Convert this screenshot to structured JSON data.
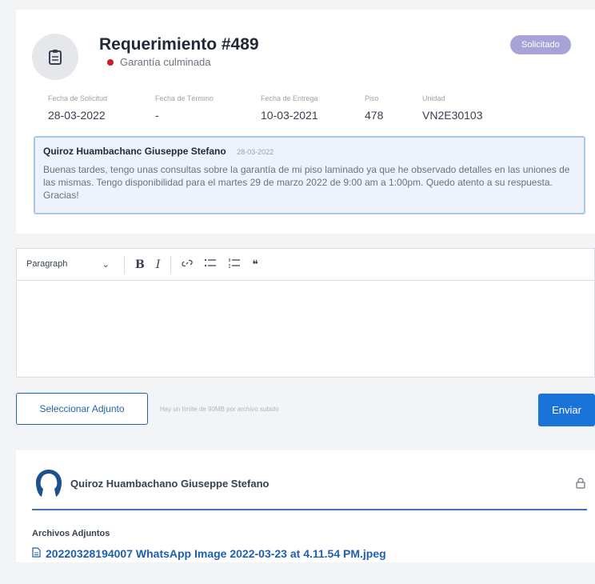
{
  "request": {
    "title": "Requerimiento #489",
    "status_text": "Garantía culminada",
    "badge": "Solicitado",
    "colors": {
      "badge": "#a8a3d6",
      "status_dot": "#c81e1e"
    }
  },
  "fields": [
    {
      "label": "Fecha de Solicitud",
      "value": "28-03-2022"
    },
    {
      "label": "Fecha de Término",
      "value": "-"
    },
    {
      "label": "Fecha de Entrega",
      "value": "10-03-2021"
    },
    {
      "label": "Piso",
      "value": "478"
    },
    {
      "label": "Unidad",
      "value": "VN2E30103"
    }
  ],
  "first_comment": {
    "author": "Quiroz Huambachanc Giuseppe Stefano",
    "date": "28-03-2022",
    "body": "Buenas tardes, tengo unas consultas sobre la garantía de mi piso laminado ya que he observado detalles en las uniones de las mismas. Tengo disponibilidad para el martes 29 de marzo 2022 de 9:00 am a 1:00pm. Quedo atento a su respuesta. Gracias!"
  },
  "editor": {
    "paragraph_select": "Paragraph",
    "buttons": {
      "bold": "B",
      "italic": "I",
      "quote": "❝"
    }
  },
  "attachments": {
    "select_button": "Seleccionar Adjunto",
    "hint": "Hay un límite de 90MB por archivo subido",
    "send_button": "Enviar"
  },
  "comment_card": {
    "author": "Quiroz Huambachano Giuseppe Stefano",
    "files_label": "Archivos Adjuntos",
    "file_name": "20220328194007 WhatsApp Image 2022-03-23 at 4.11.54 PM.jpeg"
  },
  "icons": [
    "clipboard-icon",
    "link-icon",
    "bullet-list-icon",
    "numbered-list-icon",
    "quote-icon",
    "user-avatar-icon",
    "lock-icon",
    "file-icon",
    "chevron-down-icon"
  ]
}
